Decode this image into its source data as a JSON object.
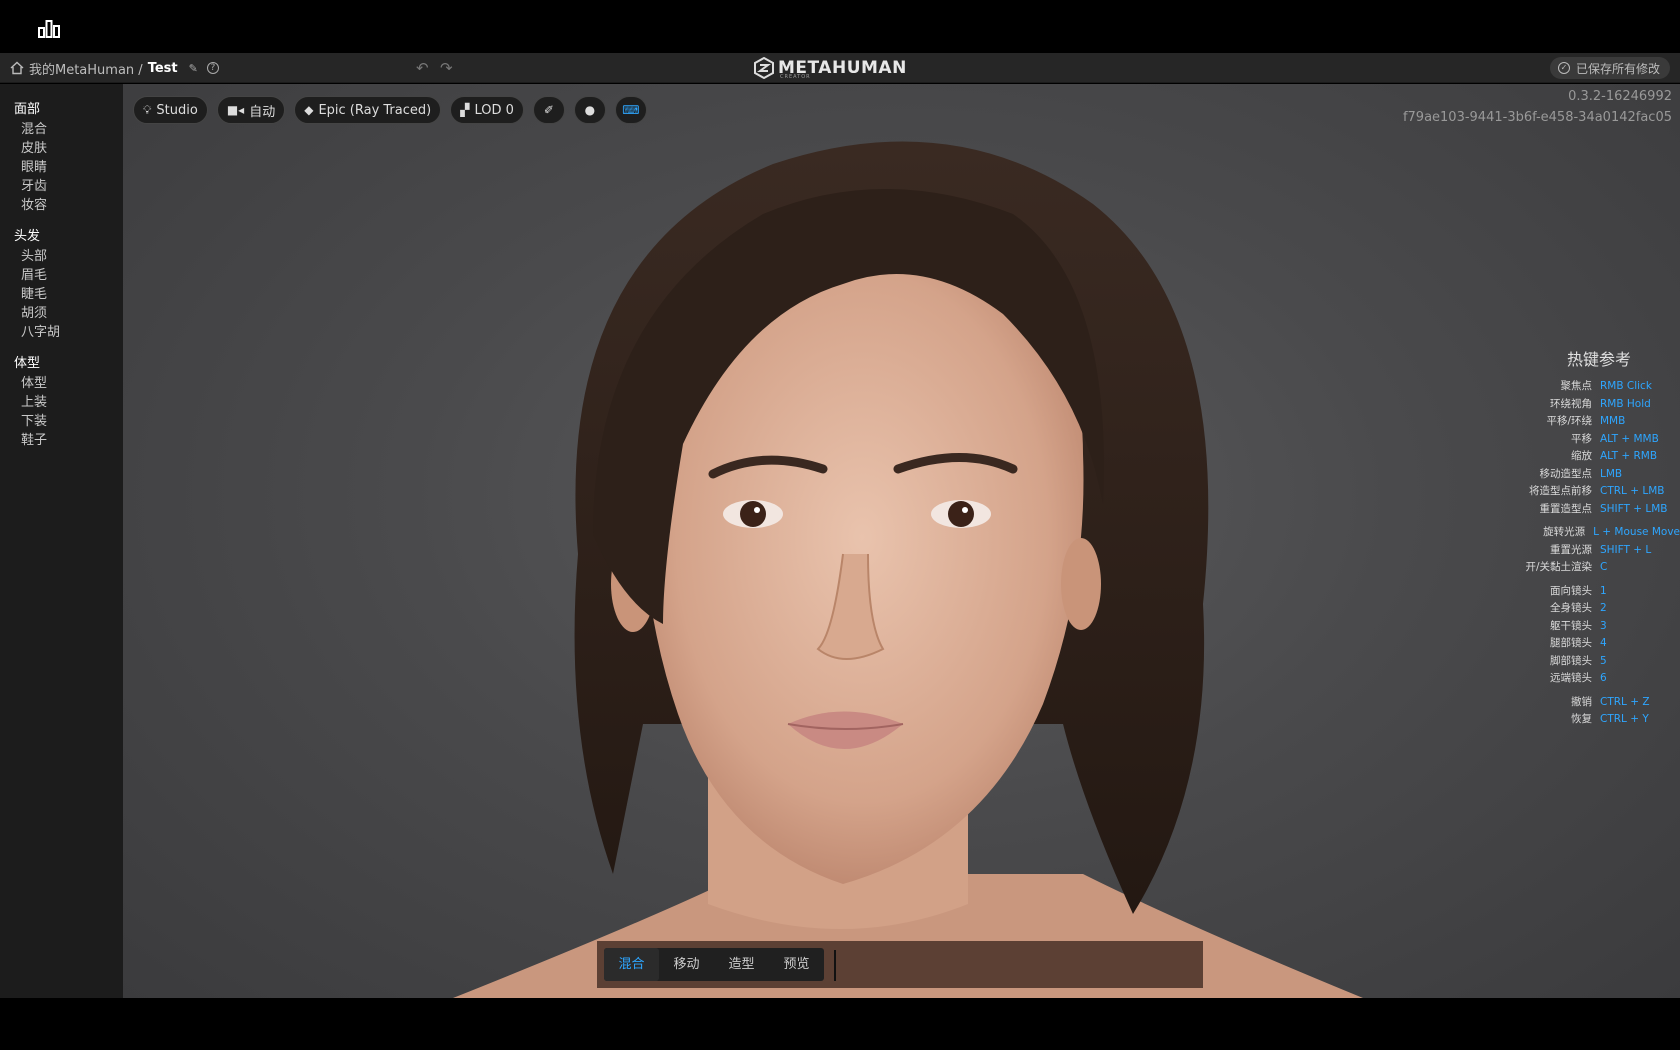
{
  "header": {
    "breadcrumb_root": "我的MetaHuman /",
    "breadcrumb_current": "Test",
    "logo_text": "METAHUMAN",
    "logo_sub": "CREATOR",
    "saved_status": "已保存所有修改"
  },
  "sidebar": {
    "groups": [
      {
        "title": "面部",
        "items": [
          "混合",
          "皮肤",
          "眼睛",
          "牙齿",
          "妆容"
        ]
      },
      {
        "title": "头发",
        "items": [
          "头部",
          "眉毛",
          "睫毛",
          "胡须",
          "八字胡"
        ]
      },
      {
        "title": "体型",
        "items": [
          "体型",
          "上装",
          "下装",
          "鞋子"
        ]
      }
    ]
  },
  "toolbar": {
    "lighting": "Studio",
    "camera": "自动",
    "quality": "Epic (Ray Traced)",
    "lod": "LOD 0"
  },
  "version": {
    "number": "0.3.2-16246992",
    "id": "f79ae103-9441-3b6f-e458-34a0142fac05"
  },
  "hotkeys": {
    "title": "热键参考",
    "items": [
      {
        "label": "聚焦点",
        "key": "RMB Click"
      },
      {
        "label": "环绕视角",
        "key": "RMB Hold"
      },
      {
        "label": "平移/环绕",
        "key": "MMB"
      },
      {
        "label": "平移",
        "key": "ALT + MMB"
      },
      {
        "label": "缩放",
        "key": "ALT + RMB"
      },
      {
        "label": "移动造型点",
        "key": "LMB"
      },
      {
        "label": "将造型点前移",
        "key": "CTRL + LMB"
      },
      {
        "label": "重置造型点",
        "key": "SHIFT + LMB"
      },
      {
        "label": "旋转光源",
        "key": "L + Mouse Move"
      },
      {
        "label": "重置光源",
        "key": "SHIFT + L"
      },
      {
        "label": "开/关黏土渲染",
        "key": "C"
      },
      {
        "label": "面向镜头",
        "key": "1"
      },
      {
        "label": "全身镜头",
        "key": "2"
      },
      {
        "label": "躯干镜头",
        "key": "3"
      },
      {
        "label": "腿部镜头",
        "key": "4"
      },
      {
        "label": "脚部镜头",
        "key": "5"
      },
      {
        "label": "远端镜头",
        "key": "6"
      },
      {
        "label": "撤销",
        "key": "CTRL + Z"
      },
      {
        "label": "恢复",
        "key": "CTRL + Y"
      }
    ]
  },
  "modes": {
    "tabs": [
      "混合",
      "移动",
      "造型",
      "预览"
    ],
    "active": "混合"
  },
  "colors": {
    "accent": "#2ea6ff",
    "sidebar_bg": "#1c1c1c",
    "header_bg": "#262626"
  }
}
